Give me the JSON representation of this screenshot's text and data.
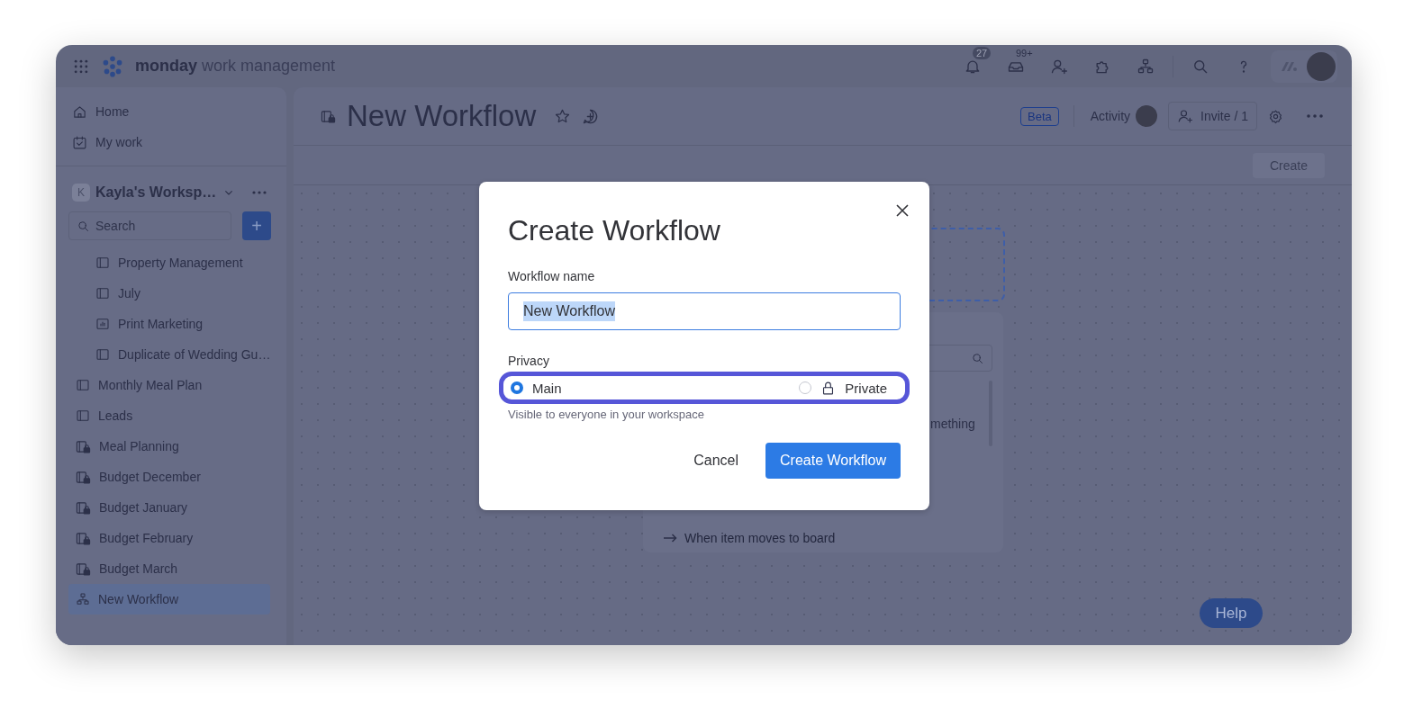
{
  "topbar": {
    "brand": "monday",
    "product": "work management",
    "notifications_badge": "27",
    "inbox_badge": "99+"
  },
  "sidebar": {
    "nav": [
      {
        "label": "Home"
      },
      {
        "label": "My work"
      }
    ],
    "workspace": {
      "initial": "K",
      "name": "Kayla's Worksp…"
    },
    "search": {
      "placeholder": "Search"
    },
    "add_button": "+",
    "boards": [
      {
        "children": [
          {
            "label": "Property Management",
            "kind": "board",
            "selected": false
          },
          {
            "label": "July",
            "kind": "board",
            "selected": false
          },
          {
            "label": "Print Marketing",
            "kind": "dashboard",
            "selected": false
          },
          {
            "label": "Duplicate of Wedding Gu…",
            "kind": "board",
            "selected": false
          }
        ]
      },
      {
        "label": "Monthly Meal Plan",
        "kind": "board",
        "selected": false
      },
      {
        "label": "Leads",
        "kind": "board",
        "selected": false
      },
      {
        "label": "Meal Planning",
        "kind": "private",
        "selected": false
      },
      {
        "label": "Budget December",
        "kind": "private",
        "selected": false
      },
      {
        "label": "Budget January",
        "kind": "private",
        "selected": false
      },
      {
        "label": "Budget February",
        "kind": "private",
        "selected": false
      },
      {
        "label": "Budget March",
        "kind": "private",
        "selected": false
      },
      {
        "label": "New Workflow",
        "kind": "workflow",
        "selected": true
      }
    ]
  },
  "board_header": {
    "title": "New Workflow",
    "beta_badge": "Beta",
    "activity": "Activity",
    "invite_button": "Invite / 1",
    "create_button": "Create"
  },
  "canvas": {
    "fragment_text": "mething",
    "triggers": [
      "When item moves to board"
    ]
  },
  "dialog": {
    "title": "Create Workflow",
    "name_label": "Workflow name",
    "name_value": "New Workflow",
    "value_selected": true,
    "privacy_label": "Privacy",
    "privacy_options": [
      {
        "label": "Main",
        "kind": "public",
        "selected": true
      },
      {
        "label": "Private",
        "kind": "private",
        "selected": false
      }
    ],
    "privacy_hint": "Visible to everyone in your workspace",
    "cancel_button": "Cancel",
    "submit_button": "Create Workflow"
  },
  "help_button": "Help"
}
